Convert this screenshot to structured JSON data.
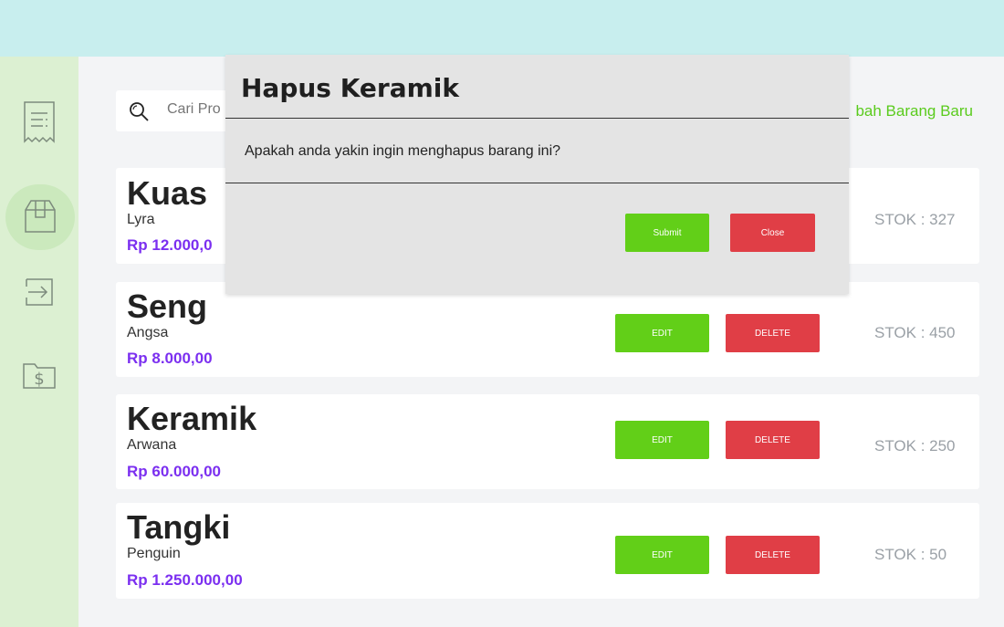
{
  "sidebar": {
    "items": [
      {
        "icon": "receipt-icon"
      },
      {
        "icon": "box-icon",
        "active": true
      },
      {
        "icon": "login-icon"
      },
      {
        "icon": "folder-money-icon"
      }
    ]
  },
  "search": {
    "placeholder": "Cari Pro",
    "icon": "search-icon"
  },
  "add_link": "bah Barang Baru",
  "products": [
    {
      "name": "Kuas",
      "brand": "Lyra",
      "price": "Rp 12.000,0",
      "stock": "STOK : 327"
    },
    {
      "name": "Seng",
      "brand": "Angsa",
      "price": "Rp 8.000,00",
      "stock": "STOK : 450",
      "edit": "EDIT",
      "delete": "DELETE"
    },
    {
      "name": "Keramik",
      "brand": "Arwana",
      "price": "Rp 60.000,00",
      "stock": "STOK : 250",
      "edit": "EDIT",
      "delete": "DELETE"
    },
    {
      "name": "Tangki",
      "brand": "Penguin",
      "price": "Rp 1.250.000,00",
      "stock": "STOK : 50",
      "edit": "EDIT",
      "delete": "DELETE"
    }
  ],
  "modal": {
    "title": "Hapus Keramik",
    "message": "Apakah anda yakin ingin menghapus barang ini?",
    "submit": "Submit",
    "close": "Close"
  },
  "colors": {
    "topbar": "#c8eeee",
    "sidebar": "#dcf0d2",
    "accent_green": "#62cf18",
    "danger_red": "#e03e46",
    "price_purple": "#7b2ff0"
  }
}
